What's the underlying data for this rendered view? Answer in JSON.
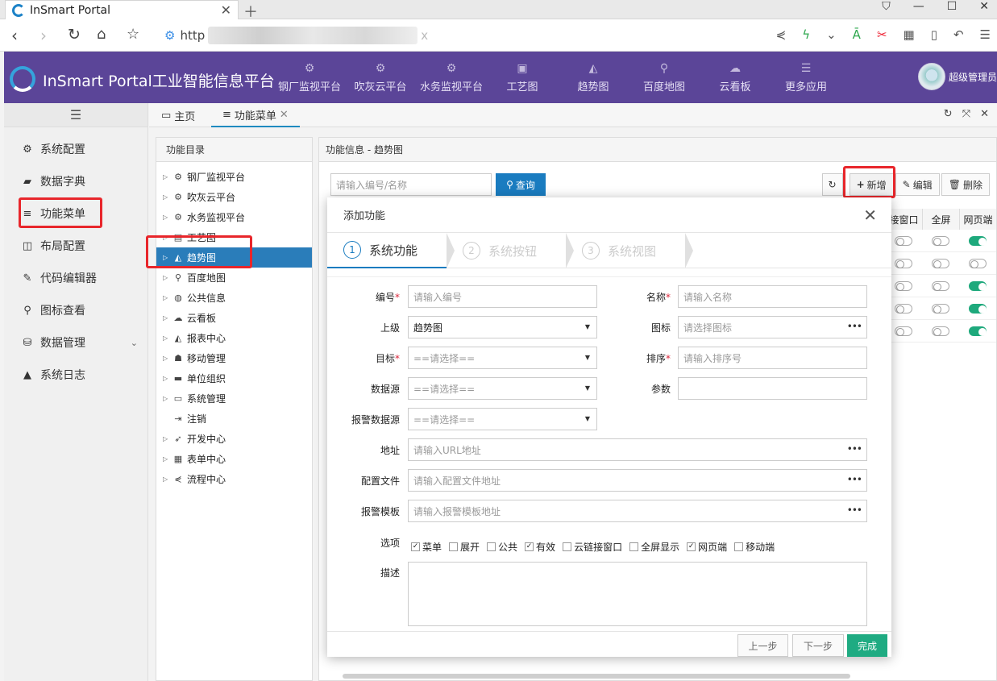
{
  "browser": {
    "tab_title": "InSmart Portal",
    "url_prefix": "http",
    "url_tail": "x"
  },
  "app": {
    "title": "InSmart Portal工业智能信息平台",
    "topnav": [
      {
        "label": "钢厂监视平台",
        "icon": "gears-icon"
      },
      {
        "label": "吹灰云平台",
        "icon": "gears-icon"
      },
      {
        "label": "水务监视平台",
        "icon": "gears-icon"
      },
      {
        "label": "工艺图",
        "icon": "image-icon"
      },
      {
        "label": "趋势图",
        "icon": "area-chart-icon"
      },
      {
        "label": "百度地图",
        "icon": "map-marker-icon"
      },
      {
        "label": "云看板",
        "icon": "cloud-icon"
      },
      {
        "label": "更多应用",
        "icon": "menu-icon"
      }
    ],
    "user": "超级管理员"
  },
  "sidebar": {
    "items": [
      {
        "label": "系统配置",
        "icon": "gear-icon"
      },
      {
        "label": "数据字典",
        "icon": "book-icon"
      },
      {
        "label": "功能菜单",
        "icon": "list-icon"
      },
      {
        "label": "布局配置",
        "icon": "columns-icon"
      },
      {
        "label": "代码编辑器",
        "icon": "edit-icon"
      },
      {
        "label": "图标查看",
        "icon": "search-icon"
      },
      {
        "label": "数据管理",
        "icon": "database-icon"
      },
      {
        "label": "系统日志",
        "icon": "warning-icon"
      }
    ]
  },
  "pagetabs": [
    {
      "label": "主页"
    },
    {
      "label": "功能菜单"
    }
  ],
  "directory": {
    "title": "功能目录",
    "items": [
      {
        "label": "钢厂监视平台",
        "icon": "gears-icon"
      },
      {
        "label": "吹灰云平台",
        "icon": "gears-icon"
      },
      {
        "label": "水务监视平台",
        "icon": "gears-icon"
      },
      {
        "label": "工艺图",
        "icon": "file-image-icon"
      },
      {
        "label": "趋势图",
        "icon": "area-chart-icon"
      },
      {
        "label": "百度地图",
        "icon": "map-marker-icon"
      },
      {
        "label": "公共信息",
        "icon": "globe-icon"
      },
      {
        "label": "云看板",
        "icon": "cloud-icon"
      },
      {
        "label": "报表中心",
        "icon": "area-chart-icon"
      },
      {
        "label": "移动管理",
        "icon": "android-icon"
      },
      {
        "label": "单位组织",
        "icon": "keyboard-icon"
      },
      {
        "label": "系统管理",
        "icon": "desktop-icon"
      },
      {
        "label": "注销",
        "icon": "sign-out-icon"
      },
      {
        "label": "开发中心",
        "icon": "send-icon"
      },
      {
        "label": "表单中心",
        "icon": "table-icon"
      },
      {
        "label": "流程中心",
        "icon": "share-icon"
      }
    ]
  },
  "info": {
    "title": "功能信息 - 趋势图",
    "search_placeholder": "请输入编号/名称",
    "query_label": "查询",
    "add_label": "新增",
    "edit_label": "编辑",
    "delete_label": "删除",
    "columns": [
      "接窗口",
      "全屏",
      "网页端"
    ],
    "toggle_rows": [
      [
        false,
        false,
        true
      ],
      [
        false,
        false,
        false
      ],
      [
        false,
        false,
        true
      ],
      [
        false,
        false,
        true
      ],
      [
        false,
        false,
        true
      ]
    ]
  },
  "modal": {
    "title": "添加功能",
    "steps": [
      {
        "num": "1",
        "label": "系统功能"
      },
      {
        "num": "2",
        "label": "系统按钮"
      },
      {
        "num": "3",
        "label": "系统视图"
      }
    ],
    "fields": {
      "code_label": "编号",
      "code_placeholder": "请输入编号",
      "name_label": "名称",
      "name_placeholder": "请输入名称",
      "parent_label": "上级",
      "parent_value": "趋势图",
      "icon_label": "图标",
      "icon_placeholder": "请选择图标",
      "target_label": "目标",
      "target_value": "==请选择==",
      "sort_label": "排序",
      "sort_placeholder": "请输入排序号",
      "datasource_label": "数据源",
      "datasource_value": "==请选择==",
      "param_label": "参数",
      "alarm_ds_label": "报警数据源",
      "alarm_ds_value": "==请选择==",
      "url_label": "地址",
      "url_placeholder": "请输入URL地址",
      "config_label": "配置文件",
      "config_placeholder": "请输入配置文件地址",
      "alarm_tpl_label": "报警模板",
      "alarm_tpl_placeholder": "请输入报警模板地址",
      "options_label": "选项",
      "desc_label": "描述"
    },
    "options": [
      {
        "label": "菜单",
        "checked": true
      },
      {
        "label": "展开",
        "checked": false
      },
      {
        "label": "公共",
        "checked": false
      },
      {
        "label": "有效",
        "checked": true
      },
      {
        "label": "云链接窗口",
        "checked": false
      },
      {
        "label": "全屏显示",
        "checked": false
      },
      {
        "label": "网页端",
        "checked": true
      },
      {
        "label": "移动端",
        "checked": false
      }
    ],
    "prev_label": "上一步",
    "next_label": "下一步",
    "done_label": "完成"
  },
  "colors": {
    "header": "#5b4598",
    "primary": "#1a7cc0",
    "success": "#1fab82",
    "highlight": "#e8262b"
  }
}
